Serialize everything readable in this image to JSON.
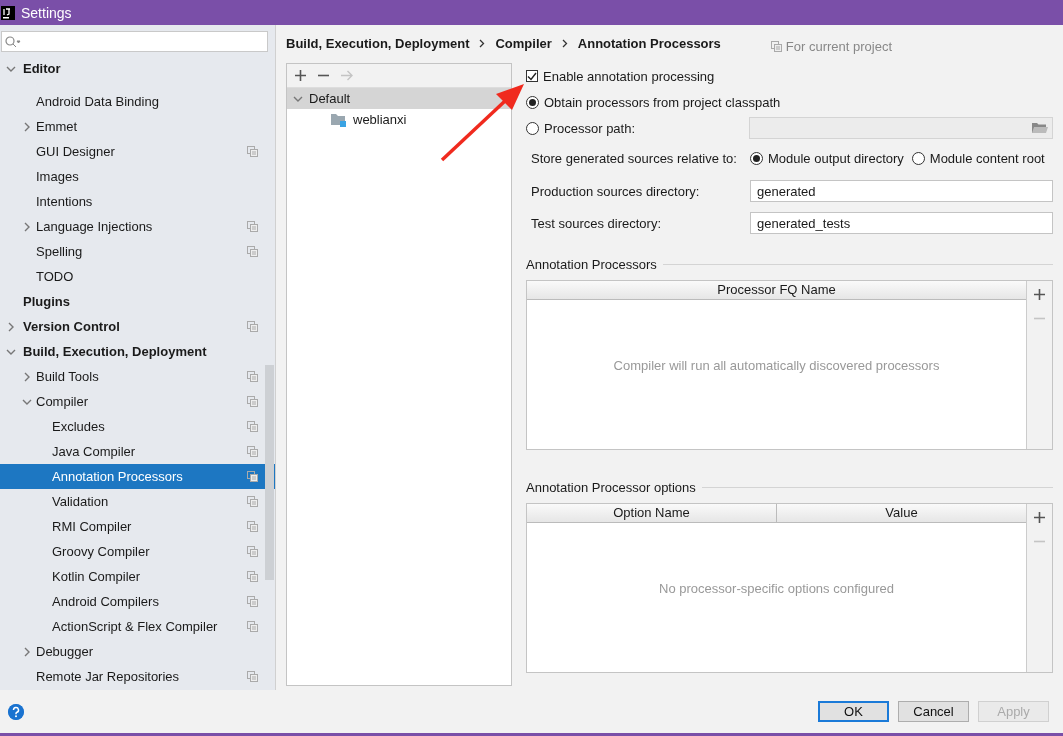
{
  "window": {
    "title": "Settings"
  },
  "sidebar": {
    "items": [
      {
        "label": "Editor",
        "kind": "branch",
        "expanded": true,
        "selected": false,
        "project_scope": false,
        "children": [
          {
            "label": "Android Data Binding",
            "kind": "leaf",
            "selected": false,
            "project_scope": false
          },
          {
            "label": "Emmet",
            "kind": "branch",
            "expanded": false,
            "selected": false,
            "project_scope": false
          },
          {
            "label": "GUI Designer",
            "kind": "leaf",
            "selected": false,
            "project_scope": true
          },
          {
            "label": "Images",
            "kind": "leaf",
            "selected": false,
            "project_scope": false
          },
          {
            "label": "Intentions",
            "kind": "leaf",
            "selected": false,
            "project_scope": false
          },
          {
            "label": "Language Injections",
            "kind": "branch",
            "expanded": false,
            "selected": false,
            "project_scope": true
          },
          {
            "label": "Spelling",
            "kind": "leaf",
            "selected": false,
            "project_scope": true
          },
          {
            "label": "TODO",
            "kind": "leaf",
            "selected": false,
            "project_scope": false
          }
        ]
      },
      {
        "label": "Plugins",
        "kind": "leaf",
        "selected": false,
        "project_scope": false
      },
      {
        "label": "Version Control",
        "kind": "branch",
        "expanded": false,
        "selected": false,
        "project_scope": true
      },
      {
        "label": "Build, Execution, Deployment",
        "kind": "branch",
        "expanded": true,
        "selected": false,
        "project_scope": false,
        "children": [
          {
            "label": "Build Tools",
            "kind": "branch",
            "expanded": false,
            "selected": false,
            "project_scope": true
          },
          {
            "label": "Compiler",
            "kind": "branch",
            "expanded": true,
            "selected": false,
            "project_scope": true,
            "children": [
              {
                "label": "Excludes",
                "kind": "leaf",
                "selected": false,
                "project_scope": true
              },
              {
                "label": "Java Compiler",
                "kind": "leaf",
                "selected": false,
                "project_scope": true
              },
              {
                "label": "Annotation Processors",
                "kind": "leaf",
                "selected": true,
                "project_scope": true
              },
              {
                "label": "Validation",
                "kind": "leaf",
                "selected": false,
                "project_scope": true
              },
              {
                "label": "RMI Compiler",
                "kind": "leaf",
                "selected": false,
                "project_scope": true
              },
              {
                "label": "Groovy Compiler",
                "kind": "leaf",
                "selected": false,
                "project_scope": true
              },
              {
                "label": "Kotlin Compiler",
                "kind": "leaf",
                "selected": false,
                "project_scope": true
              },
              {
                "label": "Android Compilers",
                "kind": "leaf",
                "selected": false,
                "project_scope": true
              },
              {
                "label": "ActionScript & Flex Compiler",
                "kind": "leaf",
                "selected": false,
                "project_scope": true
              }
            ]
          },
          {
            "label": "Debugger",
            "kind": "branch",
            "expanded": false,
            "selected": false,
            "project_scope": false
          },
          {
            "label": "Remote Jar Repositories",
            "kind": "leaf",
            "selected": false,
            "project_scope": true
          }
        ]
      }
    ]
  },
  "breadcrumb": [
    "Build, Execution, Deployment",
    "Compiler",
    "Annotation Processors"
  ],
  "scope_hint": "For current project",
  "profiles": {
    "toolbar": [
      {
        "kind": "add",
        "disabled": false
      },
      {
        "kind": "remove",
        "disabled": false
      },
      {
        "kind": "move",
        "disabled": true
      }
    ],
    "tree": [
      {
        "label": "Default",
        "kind": "profile",
        "expanded": true,
        "selected": true,
        "children": [
          {
            "label": "weblianxi",
            "kind": "module",
            "selected": false
          }
        ]
      }
    ]
  },
  "options": {
    "enable": {
      "label": "Enable annotation processing",
      "checked": true
    },
    "source": [
      {
        "label": "Obtain processors from project classpath",
        "selected": true
      },
      {
        "label": "Processor path:",
        "selected": false
      }
    ],
    "processor_path": {
      "disabled": true
    },
    "store": {
      "label": "Store generated sources relative to:",
      "choices": [
        {
          "label": "Module output directory",
          "selected": true
        },
        {
          "label": "Module content root",
          "selected": false
        }
      ]
    },
    "fields": [
      {
        "label": "Production sources directory:",
        "value": "generated"
      },
      {
        "label": "Test sources directory:",
        "value": "generated_tests"
      }
    ]
  },
  "tables": [
    {
      "title": "Annotation Processors",
      "columns": [
        "Processor FQ Name"
      ],
      "empty_text": "Compiler will run all automatically discovered processors",
      "tools": [
        {
          "kind": "add",
          "disabled": false
        },
        {
          "kind": "remove",
          "disabled": true
        }
      ]
    },
    {
      "title": "Annotation Processor options",
      "columns": [
        "Option Name",
        "Value"
      ],
      "empty_text": "No processor-specific options configured",
      "tools": [
        {
          "kind": "add",
          "disabled": false
        },
        {
          "kind": "remove",
          "disabled": true
        }
      ]
    }
  ],
  "buttons": [
    {
      "label": "OK",
      "kind": "default",
      "disabled": false
    },
    {
      "label": "Cancel",
      "kind": "normal",
      "disabled": false
    },
    {
      "label": "Apply",
      "kind": "normal",
      "disabled": true
    }
  ],
  "annotation": {
    "kind": "arrow"
  }
}
